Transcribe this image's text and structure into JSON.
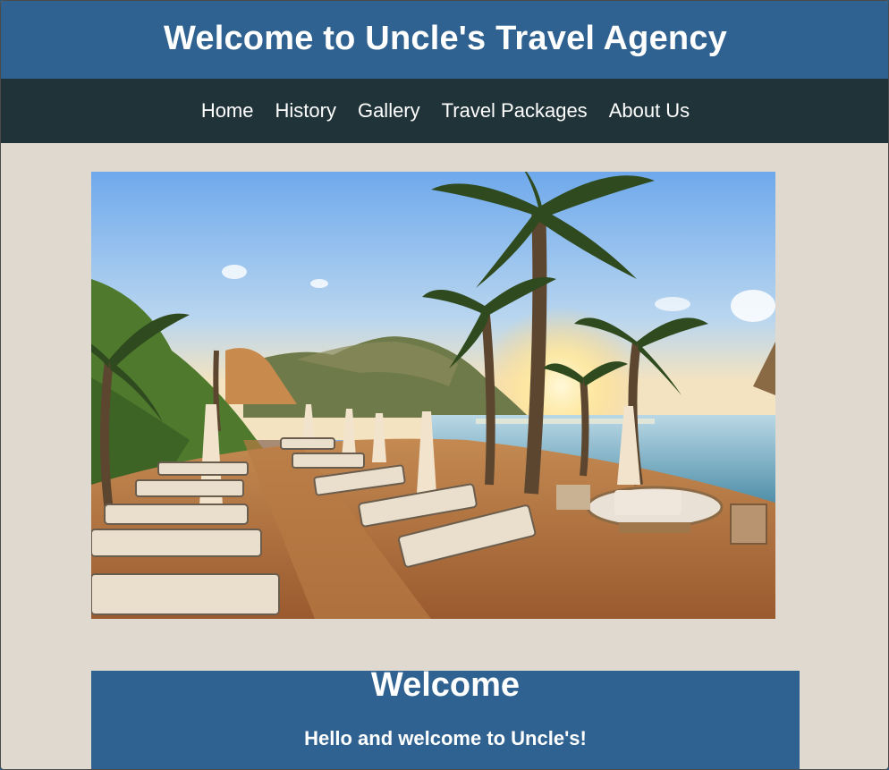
{
  "header": {
    "title": "Welcome to Uncle's Travel Agency"
  },
  "nav": {
    "items": [
      {
        "label": "Home"
      },
      {
        "label": "History"
      },
      {
        "label": "Gallery"
      },
      {
        "label": "Travel Packages"
      },
      {
        "label": "About Us"
      }
    ]
  },
  "hero": {
    "image_alt": "Beach at sunset with palm trees and lounge chairs"
  },
  "welcome": {
    "heading": "Welcome",
    "text": "Hello and welcome to Uncle's!"
  },
  "colors": {
    "header_bg": "#2f6290",
    "nav_bg": "#1f3338",
    "page_bg": "#e0d9cf",
    "text_on_dark": "#ffffff"
  }
}
